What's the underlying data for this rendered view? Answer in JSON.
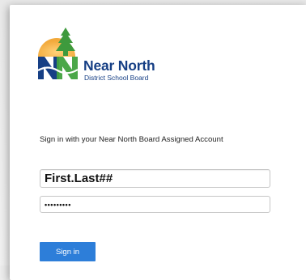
{
  "logo": {
    "name": "Near North",
    "subtitle": "District School Board"
  },
  "form": {
    "prompt": "Sign in with your Near North Board Assigned Account",
    "username_value": "First.Last##",
    "password_value": "•••••••••",
    "signin_label": "Sign in"
  },
  "colors": {
    "brand_blue": "#163f85",
    "button_blue": "#2d7ed9",
    "tree_green": "#3e9a3d",
    "sun_orange": "#f2a93b"
  }
}
